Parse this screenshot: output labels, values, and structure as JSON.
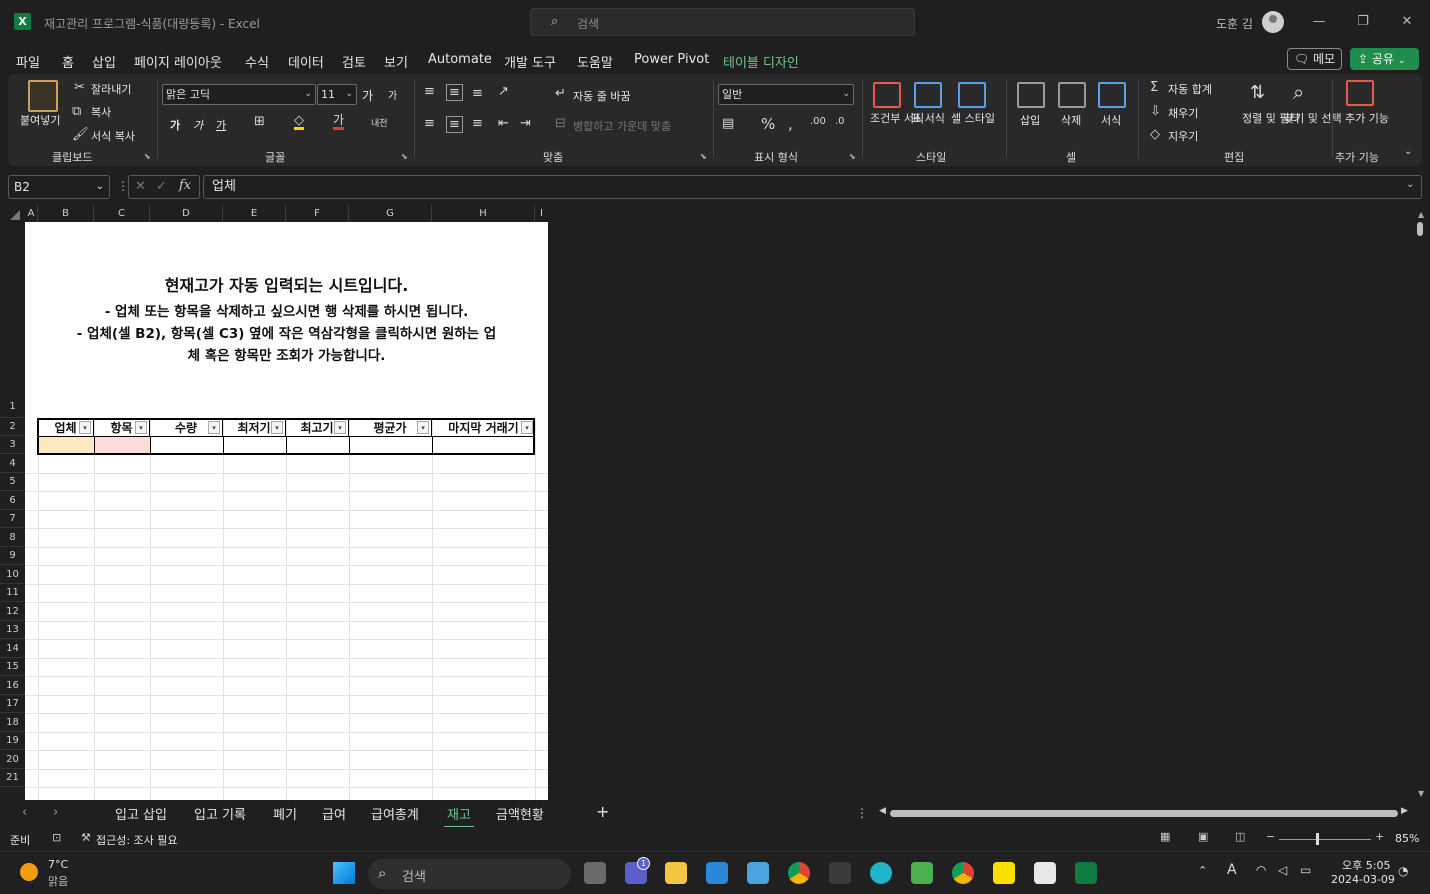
{
  "titlebar": {
    "app_icon": "X",
    "title": "재고관리 프로그램-식품(대량등록)  -  Excel",
    "search_placeholder": "검색",
    "user_name": "도훈 김",
    "minimize": "—",
    "restore": "❐",
    "close": "✕"
  },
  "menu": {
    "tabs": [
      "파일",
      "홈",
      "삽입",
      "페이지 레이아웃",
      "수식",
      "데이터",
      "검토",
      "보기",
      "Automate",
      "개발 도구",
      "도움말",
      "Power Pivot",
      "테이블 디자인"
    ],
    "active_tab": "홈",
    "memo_label": "메모",
    "share_label": "공유"
  },
  "ribbon": {
    "clipboard": {
      "paste": "붙여넣기",
      "cut": "잘라내기",
      "copy": "복사",
      "format_painter": "서식 복사",
      "group": "클립보드"
    },
    "font": {
      "name": "맑은 고딕",
      "size": "11",
      "bold": "가",
      "italic": "가",
      "underline": "가",
      "grow": "가",
      "shrink": "가",
      "group": "글꼴"
    },
    "alignment": {
      "wrap": "자동 줄 바꿈",
      "merge": "병합하고 가운데 맞춤",
      "group": "맞춤"
    },
    "number": {
      "format": "일반",
      "group": "표시 형식"
    },
    "styles": {
      "conditional": "조건부 서식",
      "table": "표 서식",
      "cell": "셀 스타일",
      "group": "스타일"
    },
    "cells": {
      "insert": "삽입",
      "delete": "삭제",
      "format": "서식",
      "group": "셀"
    },
    "editing": {
      "autosum": "자동 합계",
      "fill": "채우기",
      "clear": "지우기",
      "sort": "정렬 및 필터",
      "find": "찾기 및 선택",
      "group": "편집"
    },
    "addins": {
      "label": "추가 기능",
      "group": "추가 기능"
    }
  },
  "formula_bar": {
    "name_box": "B2",
    "content": "업체"
  },
  "grid": {
    "columns": [
      "A",
      "B",
      "C",
      "D",
      "E",
      "F",
      "G",
      "H",
      "I"
    ],
    "rows": [
      "1",
      "2",
      "3",
      "4",
      "5",
      "6",
      "7",
      "8",
      "9",
      "10",
      "11",
      "12",
      "13",
      "14",
      "15",
      "16",
      "17",
      "18",
      "19",
      "20",
      "21"
    ],
    "notice_title": "현재고가  자동 입력되는 시트입니다.",
    "notice_line1": "- 업체 또는 항목을 삭제하고 싶으시면 행 삭제를 하시면 됩니다.",
    "notice_line2": "- 업체(셀 B2), 항목(셀 C3) 옆에 작은 역삼각형을 클릭하시면 원하는 업",
    "notice_line3": "체 혹은 항목만 조회가 가능합니다.",
    "table_headers": [
      "업체",
      "항목",
      "수량",
      "최저기",
      "최고기",
      "평균가",
      "마지막 거래기"
    ]
  },
  "sheet_tabs": {
    "tabs": [
      "입고 삽입",
      "입고 기록",
      "폐기",
      "급여",
      "급여총계",
      "재고",
      "금액현황"
    ],
    "active": "재고",
    "add": "+"
  },
  "status": {
    "ready": "준비",
    "accessibility": "접근성: 조사 필요",
    "zoom": "85%"
  },
  "taskbar": {
    "weather_temp": "7°C",
    "weather_desc": "맑음",
    "search_placeholder": "검색",
    "time": "오후 5:05",
    "date": "2024-03-09",
    "teams_badge": "1"
  },
  "colors": {
    "accent": "#6fc58d",
    "excel_green": "#107c41",
    "share_green": "#1e8d4d"
  }
}
